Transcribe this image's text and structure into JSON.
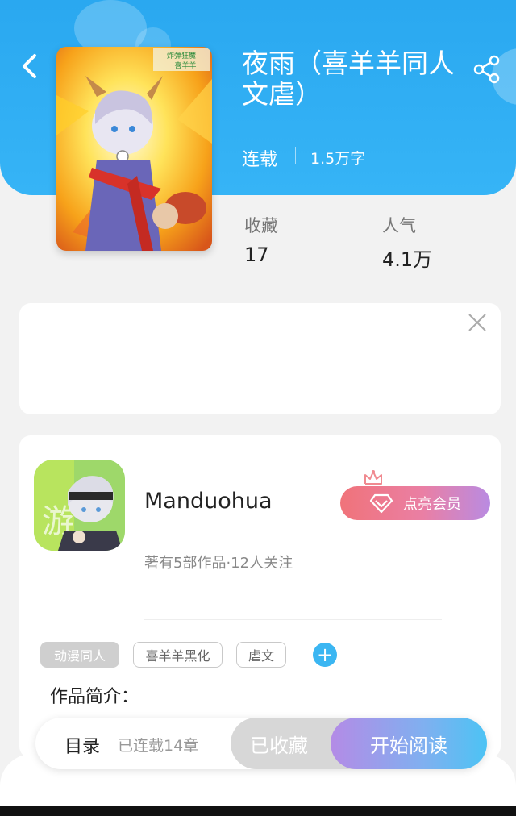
{
  "book": {
    "title": "夜雨（喜羊羊同人文虐）",
    "status": "连载",
    "word_count": "1.5万字",
    "cover_caption": "炸弹狂魔\n喜羊羊"
  },
  "stats": {
    "favorites_label": "收藏",
    "favorites_value": "17",
    "popularity_label": "人气",
    "popularity_value": "4.1万"
  },
  "author": {
    "name": "Manduohua",
    "meta": "著有5部作品·12人关注",
    "vip_label": "点亮会员"
  },
  "tags": [
    "动漫同人",
    "喜羊羊黑化",
    "虐文"
  ],
  "intro_label": "作品简介：",
  "bottom_bar": {
    "toc_label": "目录",
    "toc_count": "已连载14章",
    "favorited_label": "已收藏",
    "read_label": "开始阅读"
  },
  "colors": {
    "header_blue": "#2aa8f0",
    "tag_add_blue": "#3bb6f2",
    "vip_gradient_start": "#f0737a",
    "vip_gradient_end": "#b98be2"
  },
  "icons": {
    "back": "chevron-left-icon",
    "share": "share-icon",
    "close": "close-icon",
    "vip": "diamond-icon",
    "crown": "crown-icon",
    "add_tag": "plus-icon"
  }
}
